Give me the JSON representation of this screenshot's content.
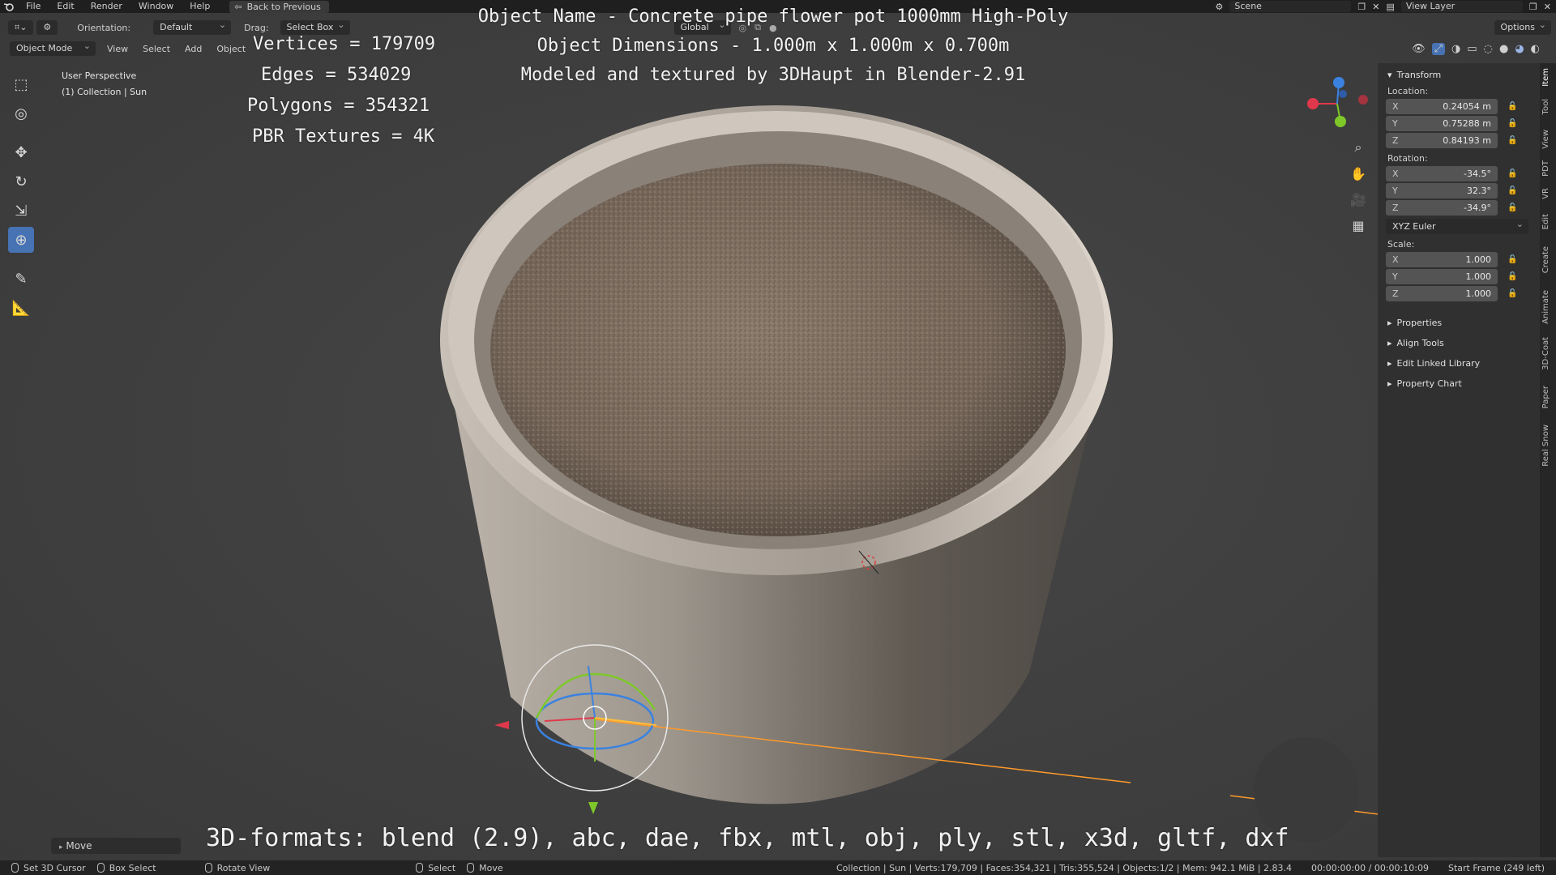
{
  "topbar": {
    "menus": [
      "File",
      "Edit",
      "Render",
      "Window",
      "Help"
    ],
    "back_label": "Back to Previous",
    "scene": "Scene",
    "view_layer": "View Layer"
  },
  "header": {
    "orientation_label": "Orientation:",
    "orientation_value": "Default",
    "drag_label": "Drag:",
    "drag_value": "Select Box",
    "transform_space": "Global",
    "options": "Options",
    "mode": "Object Mode",
    "menus": [
      "View",
      "Select",
      "Add",
      "Object"
    ]
  },
  "viewport": {
    "perspective": "User Perspective",
    "collection": "(1) Collection | Sun"
  },
  "overlay": {
    "vertices": "Vertices = 179709",
    "edges": "Edges = 534029",
    "polygons": "Polygons = 354321",
    "textures": "PBR Textures = 4K",
    "name": "Object Name - Concrete pipe flower pot 1000mm High-Poly",
    "dimensions": "Object Dimensions -  1.000m x 1.000m x 0.700m",
    "credit": "Modeled and textured by 3DHaupt in Blender-2.91",
    "formats": "3D-formats: blend (2.9), abc, dae, fbx, mtl, obj, ply, stl, x3d, gltf, dxf"
  },
  "npanel": {
    "transform": "Transform",
    "location_label": "Location:",
    "location": [
      {
        "axis": "X",
        "value": "0.24054 m"
      },
      {
        "axis": "Y",
        "value": "0.75288 m"
      },
      {
        "axis": "Z",
        "value": "0.84193 m"
      }
    ],
    "rotation_label": "Rotation:",
    "rotation": [
      {
        "axis": "X",
        "value": "-34.5°"
      },
      {
        "axis": "Y",
        "value": "32.3°"
      },
      {
        "axis": "Z",
        "value": "-34.9°"
      }
    ],
    "rotation_mode": "XYZ Euler",
    "scale_label": "Scale:",
    "scale": [
      {
        "axis": "X",
        "value": "1.000"
      },
      {
        "axis": "Y",
        "value": "1.000"
      },
      {
        "axis": "Z",
        "value": "1.000"
      }
    ],
    "sections": [
      "Properties",
      "Align Tools",
      "Edit Linked Library",
      "Property Chart"
    ],
    "tabs": [
      "Item",
      "Tool",
      "View",
      "PDT",
      "VR",
      "Edit",
      "Create",
      "Animate",
      "3D-Coat",
      "Paper",
      "Real Snow"
    ]
  },
  "bottom": {
    "last_op": "Move",
    "hints": [
      "Set 3D Cursor",
      "Box Select",
      "Rotate View",
      "Select",
      "Move"
    ],
    "stats": "Collection | Sun | Verts:179,709 | Faces:354,321 | Tris:355,524 | Objects:1/2 | Mem: 942.1 MiB | 2.83.4",
    "time": "00:00:00:00 / 00:00:10:09",
    "frame": "Start Frame (249 left)"
  },
  "colors": {
    "accent": "#4772b3",
    "axis_x": "#e0384b",
    "axis_y": "#7ec82a",
    "axis_z": "#3b82e0",
    "selection": "#ff9a2a"
  }
}
